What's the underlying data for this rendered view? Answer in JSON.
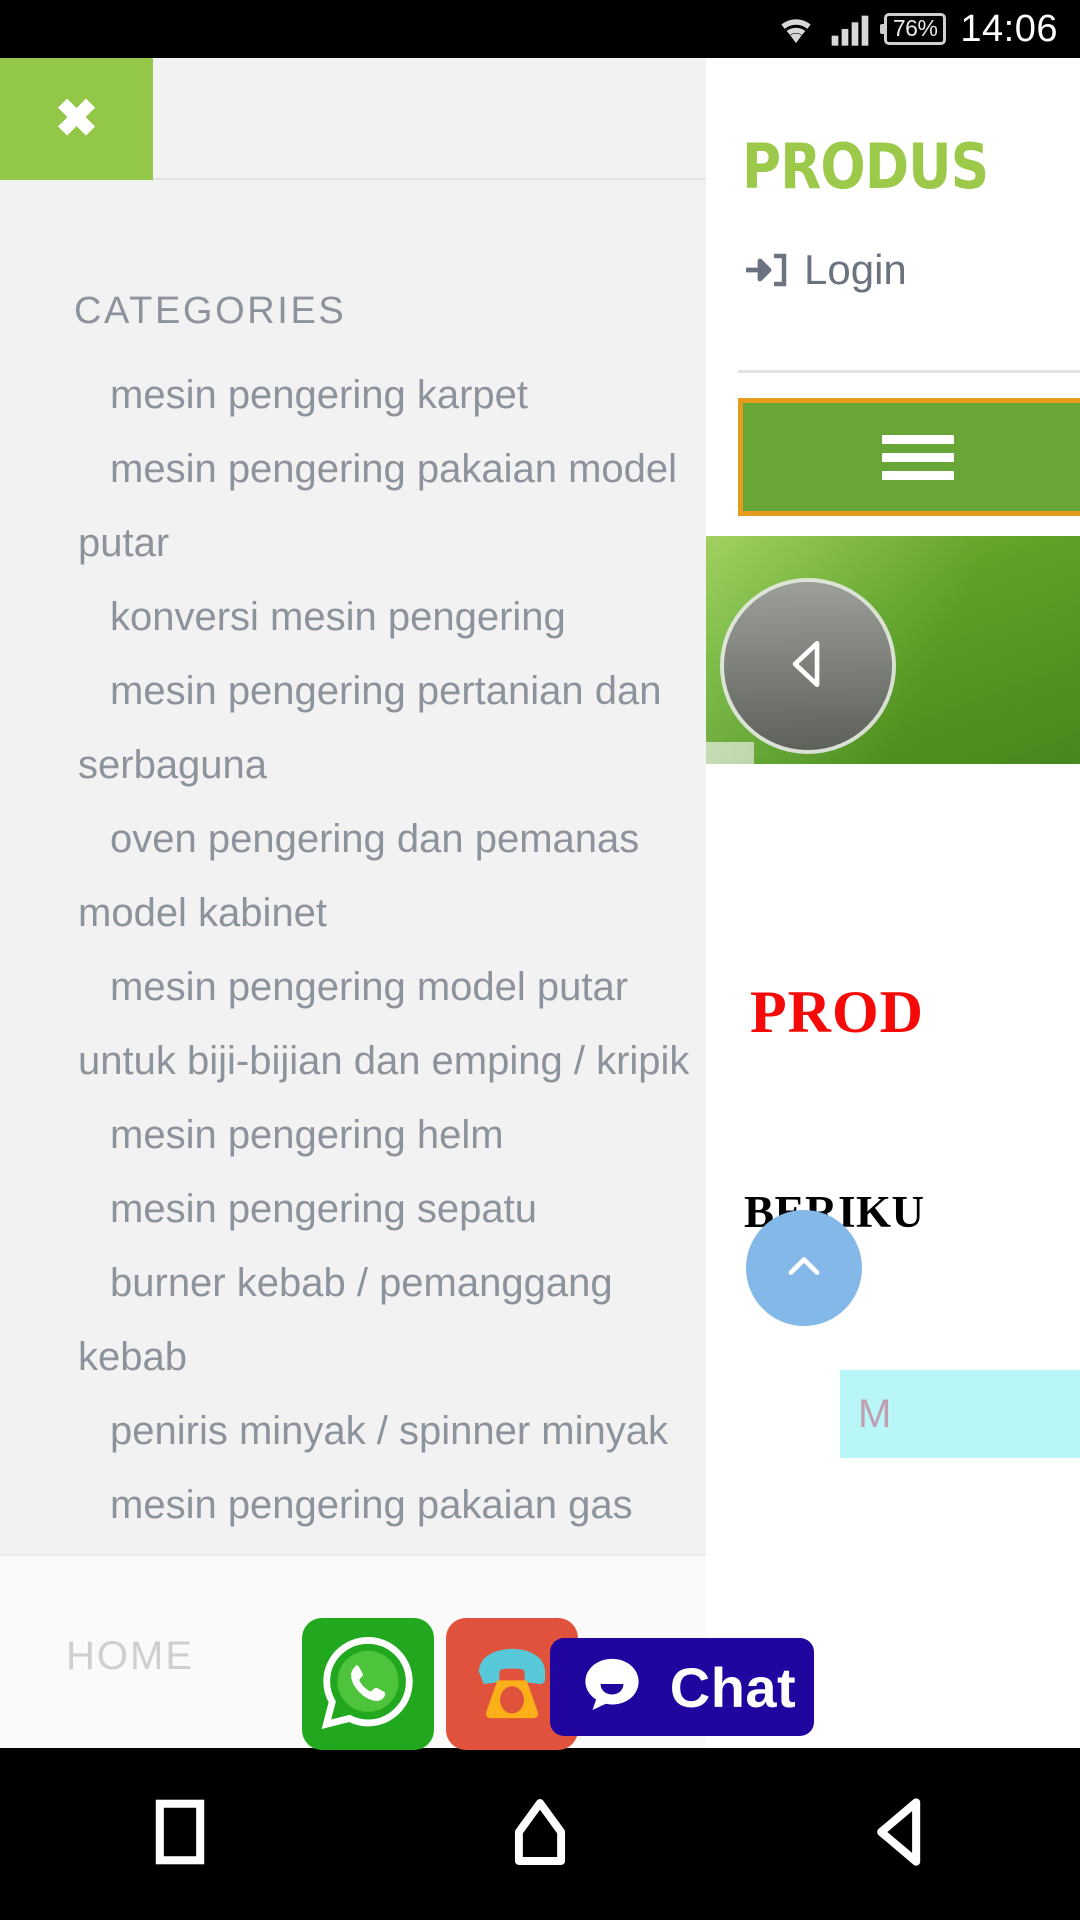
{
  "status_bar": {
    "battery_percent": "76%",
    "time": "14:06",
    "wifi_icon": "wifi-icon",
    "signal_icon": "signal-bars-icon",
    "battery_icon": "battery-icon"
  },
  "drawer": {
    "close_label": "✖",
    "section_title": "CATEGORIES",
    "categories": [
      "mesin pengering karpet",
      "mesin pengering pakaian model putar",
      "konversi mesin pengering",
      "mesin pengering pertanian dan serbaguna",
      "oven pengering dan pemanas model kabinet",
      "mesin pengering model putar untuk biji-bijian dan emping / kripik",
      "mesin pengering helm",
      "mesin pengering sepatu",
      "burner kebab / pemanggang kebab",
      "peniris minyak / spinner minyak",
      "mesin pengering pakaian gas lpg"
    ],
    "footer_link": "HOME"
  },
  "page": {
    "brand": "PRODUS",
    "login_label": "Login",
    "login_icon": "sign-in-icon",
    "menu_button_icon": "hamburger-icon",
    "carousel_prev_icon": "prev-arrow-icon",
    "red_heading": "PROD",
    "black_heading": "BERIKU",
    "scroll_top_icon": "chevron-up-icon",
    "cyan_badge_text": "M"
  },
  "floating_buttons": [
    {
      "name": "whatsapp-button",
      "icon": "whatsapp-icon",
      "label": ""
    },
    {
      "name": "phone-button",
      "icon": "telephone-icon",
      "label": ""
    },
    {
      "name": "chat-button",
      "icon": "chat-bubble-icon",
      "label": "Chat"
    }
  ],
  "nav_bar": {
    "recents_icon": "recents-square-icon",
    "home_icon": "home-icon",
    "back_icon": "back-triangle-icon"
  },
  "colors": {
    "brand_green": "#9cc94a",
    "drawer_accent": "#93c748",
    "menu_button_green": "#67a637",
    "menu_button_border": "#e59b1c",
    "red_heading": "#f60a08",
    "chat_blue": "#20069e",
    "whatsapp_green": "#22a81f",
    "phone_red": "#e0523c",
    "totop_blue": "#84b8e8",
    "cyan_badge": "#b9f6f8"
  }
}
